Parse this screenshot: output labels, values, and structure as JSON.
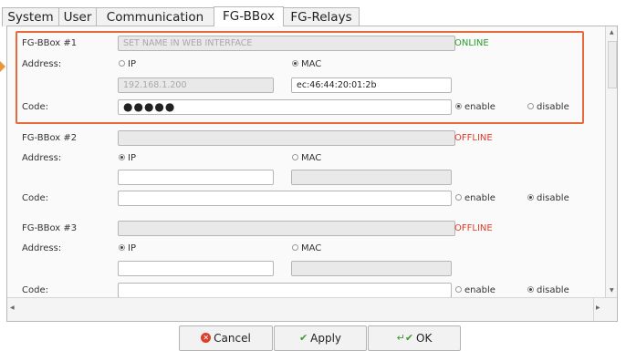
{
  "tabs": [
    {
      "label": "System",
      "active": false
    },
    {
      "label": "User",
      "active": false
    },
    {
      "label": "Communication",
      "active": false
    },
    {
      "label": "FG-BBox",
      "active": true
    },
    {
      "label": "FG-Relays",
      "active": false
    }
  ],
  "bboxes": [
    {
      "title": "FG-BBox #1",
      "name_placeholder": "SET NAME IN WEB INTERFACE",
      "status": "ONLINE",
      "status_color": "#2a9d2a",
      "address_label": "Address:",
      "ip_label": "IP",
      "mac_label": "MAC",
      "address_mode": "MAC",
      "ip_value": "192.168.1.200",
      "mac_value": "ec:46:44:20:01:2b",
      "code_label": "Code:",
      "code_value": "●●●●●",
      "enable_label": "enable",
      "disable_label": "disable",
      "code_mode": "enable"
    },
    {
      "title": "FG-BBox #2",
      "name_placeholder": "",
      "status": "OFFLINE",
      "status_color": "#e03b2b",
      "address_label": "Address:",
      "ip_label": "IP",
      "mac_label": "MAC",
      "address_mode": "IP",
      "ip_value": "",
      "mac_value": "",
      "code_label": "Code:",
      "code_value": "",
      "enable_label": "enable",
      "disable_label": "disable",
      "code_mode": "disable"
    },
    {
      "title": "FG-BBox #3",
      "name_placeholder": "",
      "status": "OFFLINE",
      "status_color": "#e03b2b",
      "address_label": "Address:",
      "ip_label": "IP",
      "mac_label": "MAC",
      "address_mode": "IP",
      "ip_value": "",
      "mac_value": "",
      "code_label": "Code:",
      "code_value": "",
      "enable_label": "enable",
      "disable_label": "disable",
      "code_mode": "disable"
    }
  ],
  "buttons": {
    "cancel": "Cancel",
    "apply": "Apply",
    "ok": "OK"
  },
  "icons": {
    "cancel": "cancel-circle-icon",
    "apply": "checkmark-icon",
    "ok": "return-check-icon"
  }
}
